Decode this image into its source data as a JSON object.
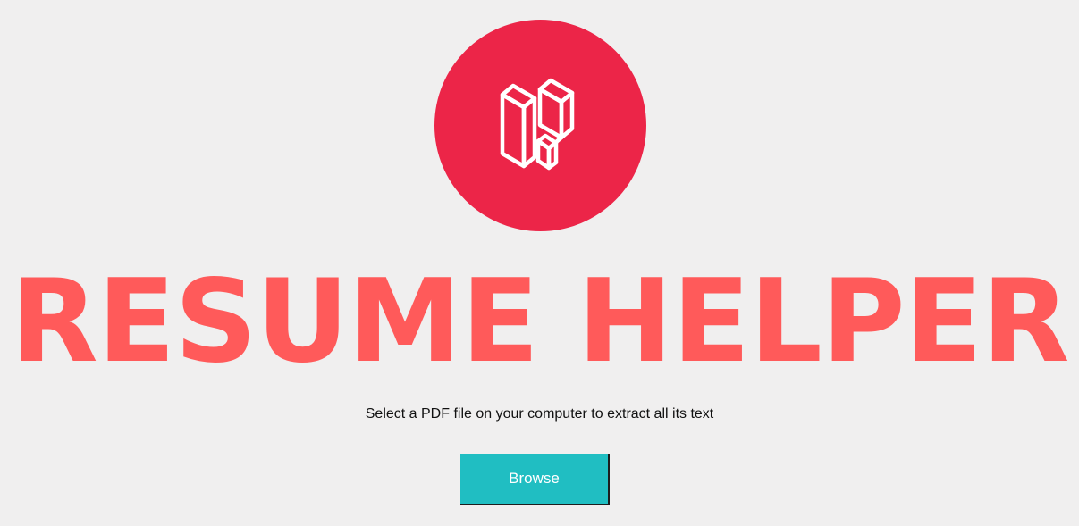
{
  "logo": {
    "icon": "laravel-logo-icon",
    "circle_color": "#ec2548"
  },
  "title": "RESUME HELPER",
  "title_color": "#ff5a5a",
  "subtitle": "Select a PDF file on your computer to extract all its text",
  "browse_button": {
    "label": "Browse",
    "color": "#20bec2"
  },
  "background_color": "#f0efef"
}
